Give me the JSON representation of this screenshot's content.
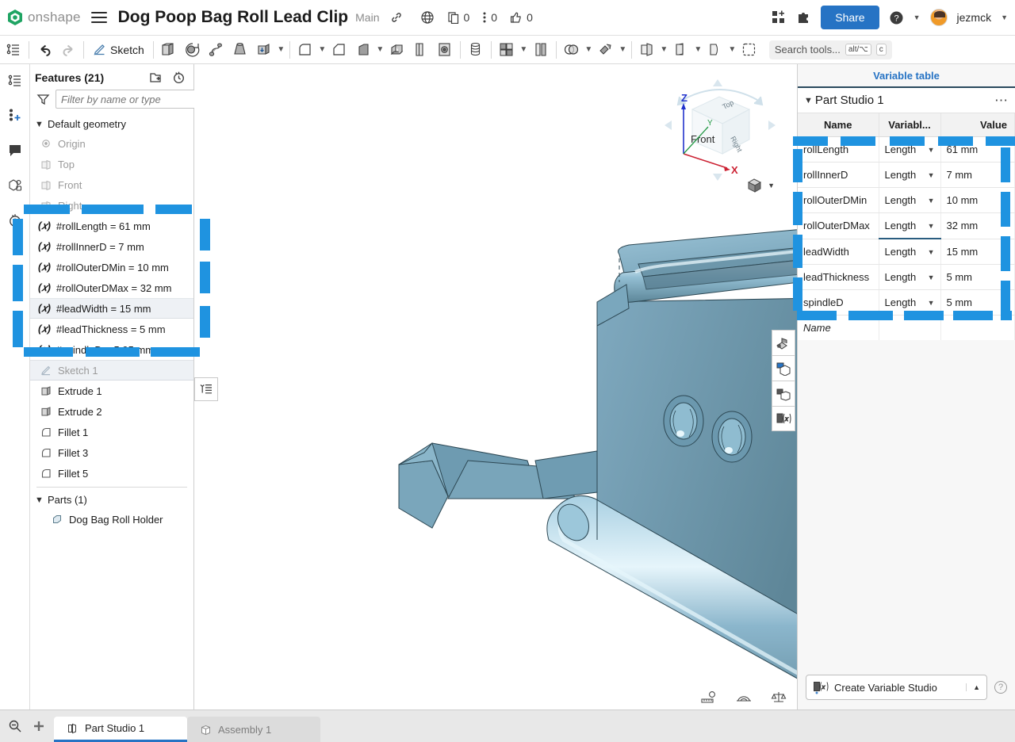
{
  "topbar": {
    "brand": "onshape",
    "document_title": "Dog Poop Bag Roll Lead Clip",
    "branch": "Main",
    "link_icon": "link-icon",
    "globe_icon": "globe-icon",
    "copy_count": "0",
    "comment_count": "0",
    "like_count": "0",
    "apps_icon": "apps-grid-icon",
    "extension_icon": "puzzle-icon",
    "share_label": "Share",
    "help_icon": "help-icon",
    "username": "jezmck"
  },
  "toolbar": {
    "feature_list_icon": "feature-list-icon",
    "undo_icon": "undo-arrow-icon",
    "redo_icon": "redo-arrow-icon",
    "sketch_label": "Sketch",
    "search_placeholder": "Search tools...",
    "search_kbd_1": "alt/⌥",
    "search_kbd_2": "c",
    "tools": [
      "extrude-icon",
      "revolve-icon",
      "sweep-icon",
      "loft-icon",
      "thicken-icon",
      "fillet-icon",
      "chamfer-icon",
      "draft-icon",
      "shell-icon",
      "rib-icon",
      "hole-icon",
      "pattern-icon",
      "mirror-icon",
      "boolean-icon",
      "split-icon",
      "transform-icon",
      "plane-icon",
      "offset-surface-icon",
      "more-tools-icon"
    ]
  },
  "rail": {
    "items": [
      "feature-list-icon",
      "insert-part-icon",
      "comments-icon",
      "appearance-icon",
      "history-icon"
    ]
  },
  "features": {
    "title": "Features (21)",
    "add_folder_icon": "add-folder-icon",
    "rollback_icon": "rollback-timer-icon",
    "filter_icon": "filter-funnel-icon",
    "filter_placeholder": "Filter by name or type",
    "default_geometry": {
      "label": "Default geometry",
      "items": [
        {
          "label": "Origin",
          "icon": "origin-icon"
        },
        {
          "label": "Top",
          "icon": "plane-icon"
        },
        {
          "label": "Front",
          "icon": "plane-icon"
        },
        {
          "label": "Right",
          "icon": "plane-icon"
        }
      ]
    },
    "variables": [
      {
        "label": "#rollLength = 61 mm",
        "selected": false
      },
      {
        "label": "#rollInnerD = 7 mm",
        "selected": false
      },
      {
        "label": "#rollOuterDMin = 10 mm",
        "selected": false
      },
      {
        "label": "#rollOuterDMax = 32 mm",
        "selected": false
      },
      {
        "label": "#leadWidth = 15 mm",
        "selected": true
      },
      {
        "label": "#leadThickness = 5 mm",
        "selected": false
      },
      {
        "label": "#spindleD = 5.95 mm",
        "selected": false
      }
    ],
    "items": [
      {
        "label": "Sketch 1",
        "icon": "sketch-icon",
        "dim": true,
        "selected": true
      },
      {
        "label": "Extrude 1",
        "icon": "extrude-icon",
        "dim": false,
        "selected": false
      },
      {
        "label": "Extrude 2",
        "icon": "extrude-icon",
        "dim": false,
        "selected": false
      },
      {
        "label": "Fillet 1",
        "icon": "fillet-icon",
        "dim": false,
        "selected": false
      },
      {
        "label": "Fillet 3",
        "icon": "fillet-icon",
        "dim": false,
        "selected": false
      },
      {
        "label": "Fillet 5",
        "icon": "fillet-icon",
        "dim": false,
        "selected": false
      }
    ],
    "parts": {
      "label": "Parts (1)",
      "items": [
        {
          "label": "Dog Bag Roll Holder",
          "icon": "part-icon"
        }
      ]
    }
  },
  "viewport": {
    "rollup_icon": "feature-rollup-icon",
    "viewcube": {
      "top_label": "Top",
      "front_label": "Front",
      "right_label": "Right",
      "axis_x": "X",
      "axis_y": "Y",
      "axis_z": "Z"
    },
    "view_dropdown_icon": "view-orientation-icon",
    "right_tools": [
      "section-view-icon",
      "display-state-icon",
      "render-icon",
      "variable-studio-icon"
    ],
    "measure_tools": [
      "measure-ruler-icon",
      "measure-angle-icon",
      "mass-properties-icon"
    ],
    "model_colors": {
      "body_mid": "#6f9fb8",
      "body_dark": "#5b8296",
      "body_light": "#aed3e4",
      "edge": "#2d4854",
      "highlight": "#e8f6fb"
    }
  },
  "variable_panel": {
    "tab_label": "Variable table",
    "studio_name": "Part Studio 1",
    "more_icon": "more-options-icon",
    "columns": [
      "Name",
      "Variabl...",
      "Value"
    ],
    "rows": [
      {
        "name": "rollLength",
        "type": "Length",
        "value": "61 mm",
        "focus": false
      },
      {
        "name": "rollInnerD",
        "type": "Length",
        "value": "7 mm",
        "focus": false
      },
      {
        "name": "rollOuterDMin",
        "type": "Length",
        "value": "10 mm",
        "focus": false
      },
      {
        "name": "rollOuterDMax",
        "type": "Length",
        "value": "32 mm",
        "focus": true
      },
      {
        "name": "leadWidth",
        "type": "Length",
        "value": "15 mm",
        "focus": false
      },
      {
        "name": "leadThickness",
        "type": "Length",
        "value": "5 mm",
        "focus": false
      },
      {
        "name": "spindleD",
        "type": "Length",
        "value": "5 mm",
        "focus": false
      }
    ],
    "new_row_placeholder": "Name",
    "create_button_label": "Create Variable Studio",
    "create_button_icon": "variable-studio-icon",
    "help_icon": "help-question-icon"
  },
  "bottom": {
    "search_icon": "document-search-icon",
    "add_tab_icon": "plus-icon",
    "tabs": [
      {
        "label": "Part Studio 1",
        "icon": "part-studio-icon",
        "active": true
      },
      {
        "label": "Assembly 1",
        "icon": "assembly-icon",
        "active": false
      }
    ]
  },
  "selection_overlay": {
    "color": "#1f93e0",
    "note": "dashed selection marquee around variable features"
  }
}
